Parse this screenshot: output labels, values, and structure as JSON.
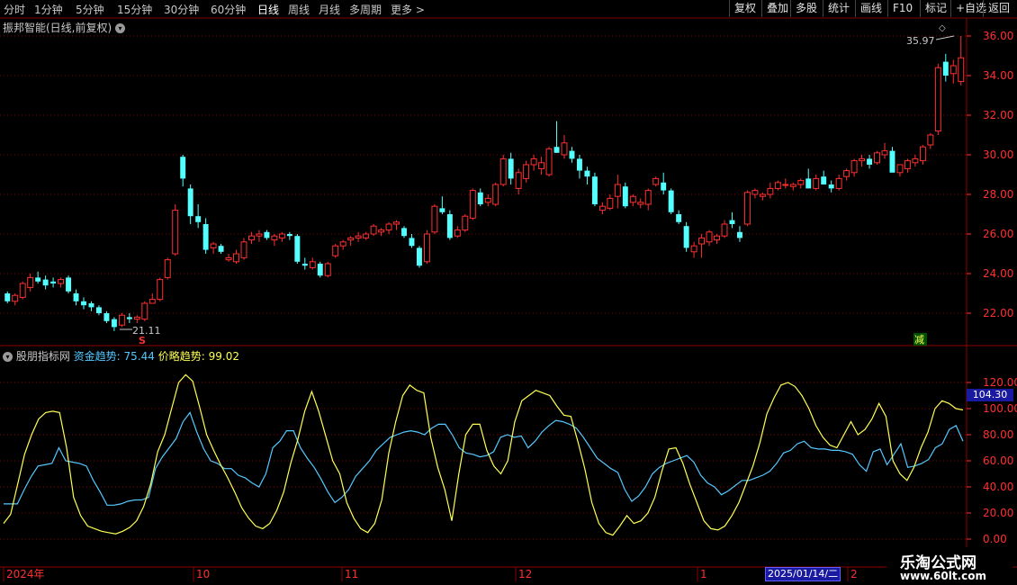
{
  "toolbar": {
    "periods": [
      "分时",
      "1分钟",
      "5分钟",
      "15分钟",
      "30分钟",
      "60分钟",
      "日线",
      "周线",
      "月线",
      "多周期",
      "更多 >"
    ],
    "active_period": "日线",
    "right_buttons": [
      "复权",
      "叠加",
      "多股",
      "统计",
      "画线",
      "F10",
      "标记",
      "+自选",
      "返回"
    ]
  },
  "main_chart": {
    "title": "振邦智能(日线,前复权)",
    "y_axis_labels": [
      "36.00",
      "34.00",
      "32.00",
      "30.00",
      "28.00",
      "26.00",
      "24.00",
      "22.00"
    ],
    "high_label": "35.97",
    "low_label": "21.11",
    "marker_s": "S",
    "marker_reduce": "减"
  },
  "indicator": {
    "name": "股朋指标网",
    "fund_label": "资金趋势:",
    "fund_value": "75.44",
    "price_label": "价略趋势:",
    "price_value": "99.02",
    "y_axis_labels": [
      "120.00",
      "100.00",
      "80.00",
      "60.00",
      "40.00",
      "20.00",
      "0.00"
    ],
    "current_value": "104.30"
  },
  "x_axis": {
    "labels": [
      "2024年",
      "10",
      "11",
      "12",
      "1",
      "2"
    ],
    "selected_date": "2025/01/14/二"
  },
  "watermark": {
    "line1": "乐淘公式网",
    "line2": "www.60lt.com"
  },
  "colors": {
    "up": "#ff3030",
    "down": "#54ffff",
    "yellow": "#ffff54",
    "cyan_line": "#54c8ff",
    "grid": "#8b0000"
  },
  "chart_data": [
    {
      "type": "candlestick",
      "title": "振邦智能(日线,前复权)",
      "ylim": [
        21,
        36.5
      ],
      "ohlc": [
        [
          23.0,
          23.1,
          22.5,
          22.6
        ],
        [
          22.6,
          23.0,
          22.4,
          22.9
        ],
        [
          22.8,
          23.6,
          22.7,
          23.5
        ],
        [
          23.3,
          24.0,
          23.1,
          23.8
        ],
        [
          23.8,
          24.1,
          23.5,
          23.6
        ],
        [
          23.7,
          23.9,
          23.2,
          23.4
        ],
        [
          23.6,
          23.8,
          23.3,
          23.5
        ],
        [
          23.5,
          23.8,
          23.3,
          23.7
        ],
        [
          23.8,
          23.9,
          23.0,
          23.1
        ],
        [
          23.0,
          23.2,
          22.4,
          22.6
        ],
        [
          22.6,
          22.8,
          22.2,
          22.4
        ],
        [
          22.5,
          22.6,
          22.1,
          22.3
        ],
        [
          22.3,
          22.4,
          21.9,
          22.0
        ],
        [
          22.0,
          22.1,
          21.5,
          21.6
        ],
        [
          21.7,
          21.8,
          21.1,
          21.3
        ],
        [
          21.4,
          22.0,
          21.3,
          21.9
        ],
        [
          21.8,
          22.0,
          21.5,
          21.7
        ],
        [
          21.7,
          21.9,
          21.5,
          21.8
        ],
        [
          21.7,
          22.6,
          21.6,
          22.5
        ],
        [
          22.5,
          23.0,
          22.5,
          22.7
        ],
        [
          22.7,
          23.8,
          22.6,
          23.7
        ],
        [
          23.8,
          24.8,
          23.7,
          24.7
        ],
        [
          25.0,
          27.5,
          24.9,
          27.2
        ],
        [
          29.9,
          30.0,
          28.4,
          28.8
        ],
        [
          28.3,
          28.5,
          26.5,
          26.9
        ],
        [
          26.9,
          27.5,
          26.3,
          26.6
        ],
        [
          26.5,
          26.8,
          25.0,
          25.2
        ],
        [
          25.3,
          25.6,
          25.0,
          25.5
        ],
        [
          25.4,
          25.5,
          25.0,
          25.1
        ],
        [
          24.7,
          25.0,
          24.6,
          24.8
        ],
        [
          24.6,
          25.2,
          24.5,
          25.0
        ],
        [
          24.8,
          25.8,
          24.7,
          25.6
        ],
        [
          25.7,
          26.1,
          25.5,
          25.9
        ],
        [
          25.9,
          26.2,
          25.6,
          26.0
        ],
        [
          26.1,
          26.2,
          25.7,
          25.8
        ],
        [
          25.7,
          26.0,
          25.4,
          25.9
        ],
        [
          25.8,
          26.1,
          25.6,
          26.0
        ],
        [
          26.0,
          26.1,
          25.7,
          25.9
        ],
        [
          25.9,
          26.0,
          24.5,
          24.6
        ],
        [
          24.5,
          24.8,
          24.2,
          24.4
        ],
        [
          24.3,
          24.8,
          24.2,
          24.6
        ],
        [
          24.5,
          24.6,
          23.8,
          23.9
        ],
        [
          23.9,
          24.6,
          23.8,
          24.5
        ],
        [
          24.9,
          25.5,
          24.8,
          25.4
        ],
        [
          25.4,
          25.7,
          25.2,
          25.6
        ],
        [
          25.7,
          25.9,
          25.4,
          25.8
        ],
        [
          25.8,
          26.1,
          25.6,
          25.9
        ],
        [
          25.8,
          26.1,
          25.7,
          26.0
        ],
        [
          26.0,
          26.5,
          25.9,
          26.4
        ],
        [
          26.1,
          26.3,
          25.9,
          26.2
        ],
        [
          26.2,
          26.6,
          26.0,
          26.5
        ],
        [
          26.5,
          26.7,
          26.2,
          26.6
        ],
        [
          26.3,
          26.4,
          25.8,
          25.9
        ],
        [
          25.8,
          26.0,
          25.3,
          25.4
        ],
        [
          25.3,
          25.4,
          24.3,
          24.4
        ],
        [
          24.6,
          26.2,
          24.5,
          26.0
        ],
        [
          26.1,
          27.5,
          26.0,
          27.4
        ],
        [
          27.3,
          27.9,
          27.0,
          27.1
        ],
        [
          27.0,
          27.2,
          25.7,
          25.8
        ],
        [
          25.9,
          26.4,
          25.8,
          26.2
        ],
        [
          26.2,
          27.0,
          26.1,
          26.9
        ],
        [
          26.8,
          28.3,
          26.7,
          28.2
        ],
        [
          28.1,
          28.3,
          27.4,
          27.5
        ],
        [
          27.6,
          28.0,
          27.4,
          27.8
        ],
        [
          27.5,
          28.6,
          27.4,
          28.5
        ],
        [
          28.5,
          30.0,
          28.4,
          29.8
        ],
        [
          29.8,
          30.1,
          28.5,
          28.8
        ],
        [
          28.3,
          29.3,
          28.0,
          29.1
        ],
        [
          28.8,
          29.7,
          28.6,
          29.5
        ],
        [
          29.5,
          30.0,
          29.2,
          29.8
        ],
        [
          29.3,
          29.9,
          29.0,
          29.6
        ],
        [
          29.0,
          30.4,
          28.9,
          30.3
        ],
        [
          30.4,
          31.7,
          30.1,
          30.1
        ],
        [
          30.0,
          31.0,
          29.8,
          30.6
        ],
        [
          30.2,
          30.4,
          29.6,
          29.8
        ],
        [
          29.8,
          30.0,
          28.8,
          29.2
        ],
        [
          29.2,
          29.4,
          28.5,
          28.9
        ],
        [
          28.9,
          29.1,
          27.4,
          27.5
        ],
        [
          27.2,
          27.6,
          27.0,
          27.4
        ],
        [
          27.3,
          28.0,
          27.2,
          27.8
        ],
        [
          27.9,
          29.0,
          27.3,
          28.5
        ],
        [
          28.4,
          28.6,
          27.3,
          27.4
        ],
        [
          27.6,
          28.0,
          27.4,
          27.9
        ],
        [
          27.5,
          27.8,
          27.3,
          27.6
        ],
        [
          27.5,
          28.3,
          27.2,
          28.2
        ],
        [
          28.5,
          28.9,
          28.4,
          28.8
        ],
        [
          28.6,
          29.1,
          28.0,
          28.2
        ],
        [
          28.2,
          28.3,
          27.0,
          27.1
        ],
        [
          27.0,
          27.2,
          26.5,
          26.6
        ],
        [
          26.4,
          26.6,
          25.1,
          25.3
        ],
        [
          25.1,
          25.6,
          24.8,
          25.4
        ],
        [
          25.5,
          26.0,
          24.8,
          25.8
        ],
        [
          25.6,
          26.2,
          25.4,
          26.1
        ],
        [
          25.7,
          26.0,
          25.5,
          25.9
        ],
        [
          25.9,
          26.7,
          25.8,
          26.5
        ],
        [
          26.7,
          27.1,
          26.3,
          26.5
        ],
        [
          26.1,
          26.4,
          25.6,
          25.8
        ],
        [
          26.5,
          28.2,
          26.4,
          28.1
        ],
        [
          28.0,
          28.3,
          27.8,
          28.2
        ],
        [
          27.9,
          28.1,
          27.7,
          28.0
        ],
        [
          28.0,
          28.6,
          27.8,
          28.3
        ],
        [
          28.3,
          28.7,
          28.2,
          28.6
        ],
        [
          28.5,
          28.8,
          28.3,
          28.5
        ],
        [
          28.4,
          28.6,
          28.2,
          28.5
        ],
        [
          28.5,
          28.8,
          28.3,
          28.7
        ],
        [
          28.8,
          29.3,
          28.7,
          28.3
        ],
        [
          28.3,
          29.0,
          28.2,
          28.8
        ],
        [
          28.9,
          29.2,
          28.6,
          28.5
        ],
        [
          28.5,
          28.7,
          28.1,
          28.3
        ],
        [
          28.3,
          29.0,
          28.2,
          28.8
        ],
        [
          28.9,
          29.3,
          28.7,
          29.2
        ],
        [
          29.1,
          29.8,
          28.9,
          29.7
        ],
        [
          29.7,
          30.0,
          29.4,
          29.8
        ],
        [
          29.8,
          30.0,
          29.3,
          29.5
        ],
        [
          29.6,
          30.2,
          29.5,
          30.1
        ],
        [
          30.0,
          30.6,
          29.8,
          30.2
        ],
        [
          30.2,
          30.4,
          29.7,
          29.1
        ],
        [
          29.1,
          29.4,
          28.9,
          29.5
        ],
        [
          29.3,
          29.8,
          29.1,
          29.7
        ],
        [
          29.6,
          30.0,
          29.4,
          29.8
        ],
        [
          29.7,
          30.5,
          29.5,
          30.4
        ],
        [
          30.5,
          31.1,
          30.3,
          31.0
        ],
        [
          31.2,
          34.6,
          31.0,
          34.4
        ],
        [
          34.7,
          35.1,
          33.7,
          34.0
        ],
        [
          34.1,
          34.8,
          33.6,
          34.5
        ],
        [
          33.7,
          36.0,
          33.5,
          34.9
        ]
      ]
    },
    {
      "type": "line",
      "ylim": [
        0,
        130
      ],
      "series": [
        {
          "name": "资金趋势",
          "color": "#54c8ff",
          "values": [
            27,
            27,
            27,
            38,
            48,
            56,
            57,
            58,
            70,
            60,
            59,
            58,
            56,
            45,
            36,
            26,
            26,
            27,
            29,
            30,
            30,
            32,
            54,
            63,
            70,
            77,
            90,
            97,
            82,
            69,
            60,
            58,
            54,
            54,
            49,
            47,
            43,
            40,
            50,
            70,
            75,
            83,
            83,
            70,
            62,
            55,
            46,
            36,
            28,
            32,
            38,
            48,
            54,
            60,
            68,
            73,
            78,
            80,
            82,
            83,
            82,
            80,
            85,
            88,
            88,
            80,
            70,
            66,
            65,
            63,
            64,
            67,
            78,
            80,
            78,
            79,
            70,
            75,
            82,
            87,
            91,
            90,
            88,
            85,
            78,
            70,
            62,
            58,
            54,
            51,
            38,
            29,
            33,
            40,
            50,
            55,
            58,
            60,
            62,
            64,
            59,
            49,
            43,
            40,
            34,
            37,
            41,
            45,
            45,
            47,
            49,
            52,
            58,
            66,
            68,
            73,
            75,
            70,
            69,
            69,
            68,
            68,
            67,
            65,
            57,
            52,
            67,
            69,
            57,
            65,
            73,
            55,
            56,
            58,
            61,
            70,
            73,
            84,
            87,
            75
          ]
        },
        {
          "name": "价略趋势",
          "color": "#ffff54",
          "values": [
            12,
            19,
            42,
            65,
            80,
            92,
            97,
            98,
            97,
            70,
            32,
            18,
            10,
            8,
            6,
            5,
            4,
            6,
            9,
            14,
            25,
            42,
            67,
            80,
            100,
            120,
            126,
            121,
            101,
            80,
            68,
            57,
            47,
            36,
            24,
            16,
            10,
            8,
            12,
            22,
            36,
            58,
            76,
            98,
            113,
            98,
            79,
            60,
            50,
            28,
            16,
            8,
            5,
            12,
            30,
            66,
            90,
            110,
            118,
            114,
            112,
            78,
            55,
            38,
            14,
            50,
            80,
            88,
            88,
            68,
            56,
            50,
            60,
            90,
            106,
            110,
            114,
            112,
            110,
            102,
            95,
            94,
            75,
            54,
            28,
            12,
            5,
            3,
            10,
            18,
            12,
            14,
            20,
            32,
            52,
            69,
            70,
            58,
            42,
            28,
            14,
            8,
            7,
            10,
            18,
            28,
            42,
            56,
            74,
            96,
            108,
            118,
            120,
            117,
            110,
            100,
            87,
            78,
            72,
            70,
            80,
            90,
            80,
            84,
            92,
            104,
            94,
            60,
            50,
            45,
            55,
            70,
            82,
            100,
            106,
            104,
            100,
            99
          ]
        }
      ],
      "y_axis_labels": [
        "120.00",
        "100.00",
        "80.00",
        "60.00",
        "40.00",
        "20.00",
        "0.00"
      ]
    }
  ]
}
